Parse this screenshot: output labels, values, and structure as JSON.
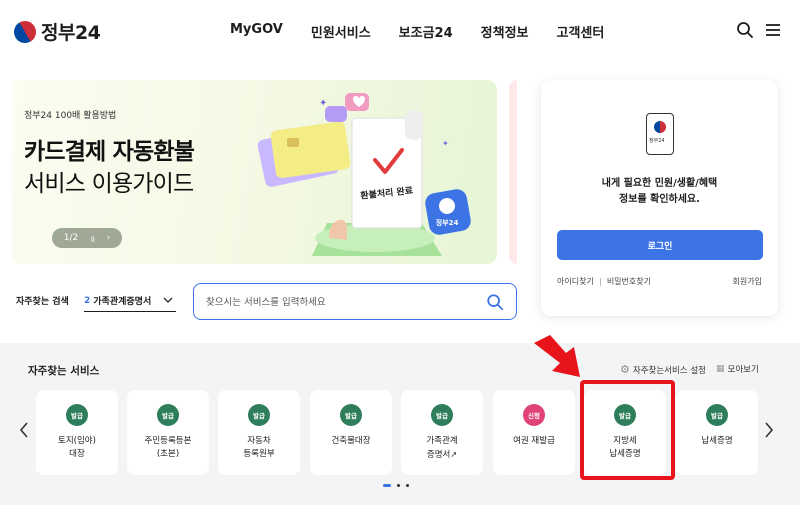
{
  "header": {
    "logo_text": "정부24",
    "nav": [
      "MyGOV",
      "민원서비스",
      "보조금24",
      "정책정보",
      "고객센터"
    ],
    "search_icon": "search-icon",
    "menu_icon": "hamburger-menu-icon"
  },
  "banner": {
    "subtitle": "정부24 100배 활용방법",
    "title_line1": "카드결제 자동환불",
    "title_line2": "서비스 이용가이드",
    "page_indicator": "1/2",
    "pause_icon": "pause-icon",
    "next_icon": "chevron-right-icon",
    "receipt_text": "환불처리 완료",
    "badge_text": "정부24"
  },
  "login": {
    "phone_text": "정부24",
    "message_line1": "내게 필요한 민원/생활/혜택",
    "message_line2": "정보를 확인하세요.",
    "button_label": "로그인",
    "find_id": "아이디찾기",
    "find_password": "비밀번호찾기",
    "join": "회원가입"
  },
  "search": {
    "label": "자주찾는 검색",
    "select_number": "2",
    "select_value": "가족관계증명서",
    "placeholder": "찾으시는 서비스를 입력하세요"
  },
  "services": {
    "title": "자주찾는 서비스",
    "settings_label": "자주찾는서비스 설정",
    "view_all_label": "모아보기",
    "cards": [
      {
        "badge": "발급",
        "line1": "토지(임야)",
        "line2": "대장"
      },
      {
        "badge": "발급",
        "line1": "주민등록등본",
        "line2": "(초본)"
      },
      {
        "badge": "발급",
        "line1": "자동차",
        "line2": "등록원부"
      },
      {
        "badge": "발급",
        "line1": "건축물대장",
        "line2": ""
      },
      {
        "badge": "발급",
        "line1": "가족관계",
        "line2": "증명서"
      },
      {
        "badge": "신청",
        "line1": "여권 재발급",
        "line2": ""
      },
      {
        "badge": "발급",
        "line1": "지방세",
        "line2": "납세증명"
      },
      {
        "badge": "발급",
        "line1": "납세증명",
        "line2": ""
      }
    ]
  },
  "colors": {
    "primary_blue": "#3c74e6",
    "badge_green": "#2e7d5b",
    "badge_pink": "#e0437a",
    "highlight_red": "#e8141c"
  }
}
